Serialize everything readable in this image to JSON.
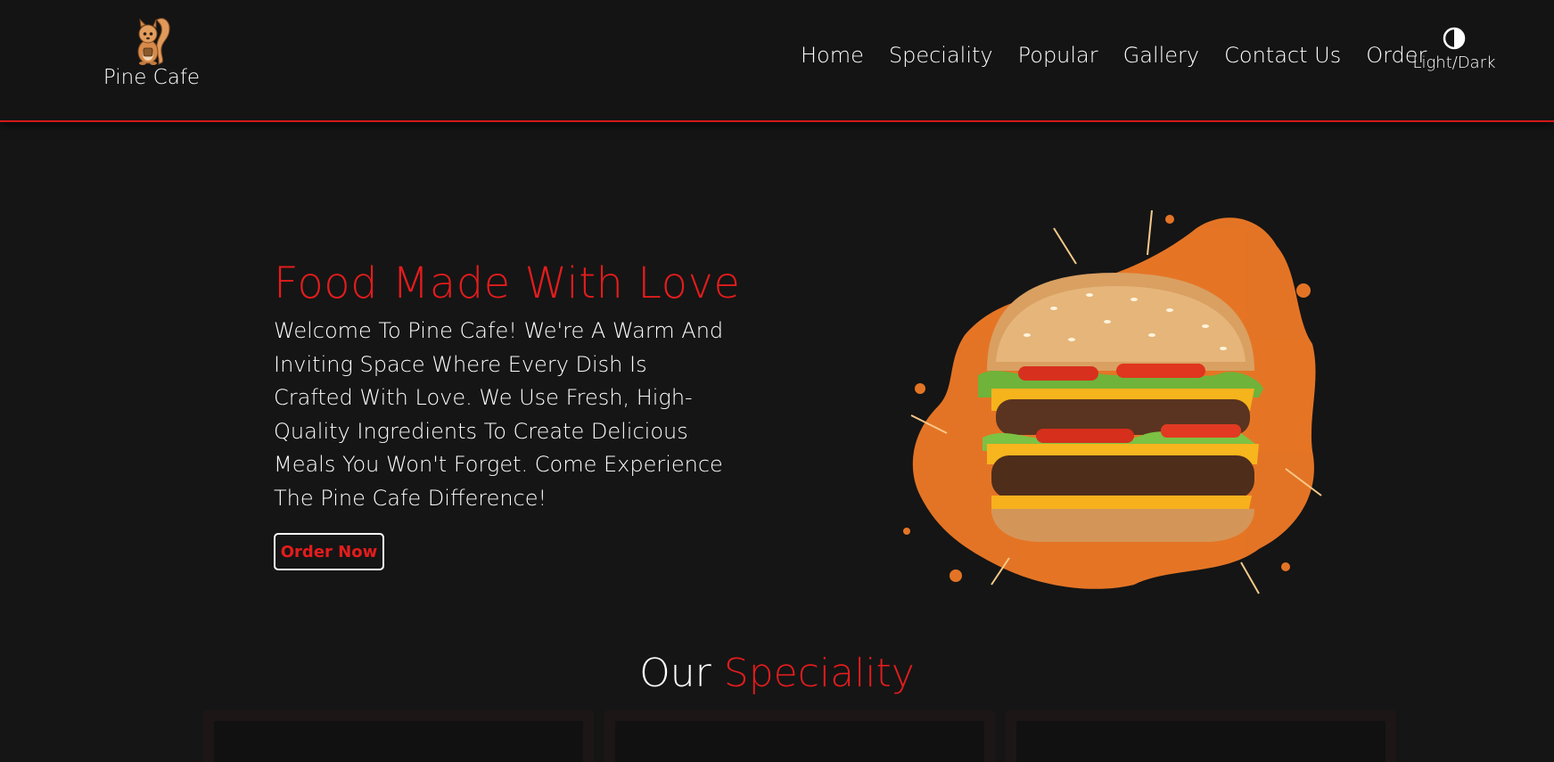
{
  "header": {
    "brand_name": "Pine Cafe",
    "nav": [
      "Home",
      "Speciality",
      "Popular",
      "Gallery",
      "Contact Us",
      "Order"
    ],
    "theme_toggle_label": "Light/Dark"
  },
  "hero": {
    "title": "Food Made With Love",
    "text": "Welcome To Pine Cafe! We're A Warm And Inviting Space Where Every Dish Is Crafted With Love. We Use Fresh, High-Quality Ingredients To Create Delicious Meals You Won't Forget. Come Experience The Pine Cafe Difference!",
    "button_label": "Order Now",
    "image_icon": "burger-image"
  },
  "speciality": {
    "title_prefix": "Our",
    "title_accent": "Speciality"
  },
  "colors": {
    "background": "#151515",
    "accent": "#e41c1c",
    "text": "#ffffff"
  }
}
